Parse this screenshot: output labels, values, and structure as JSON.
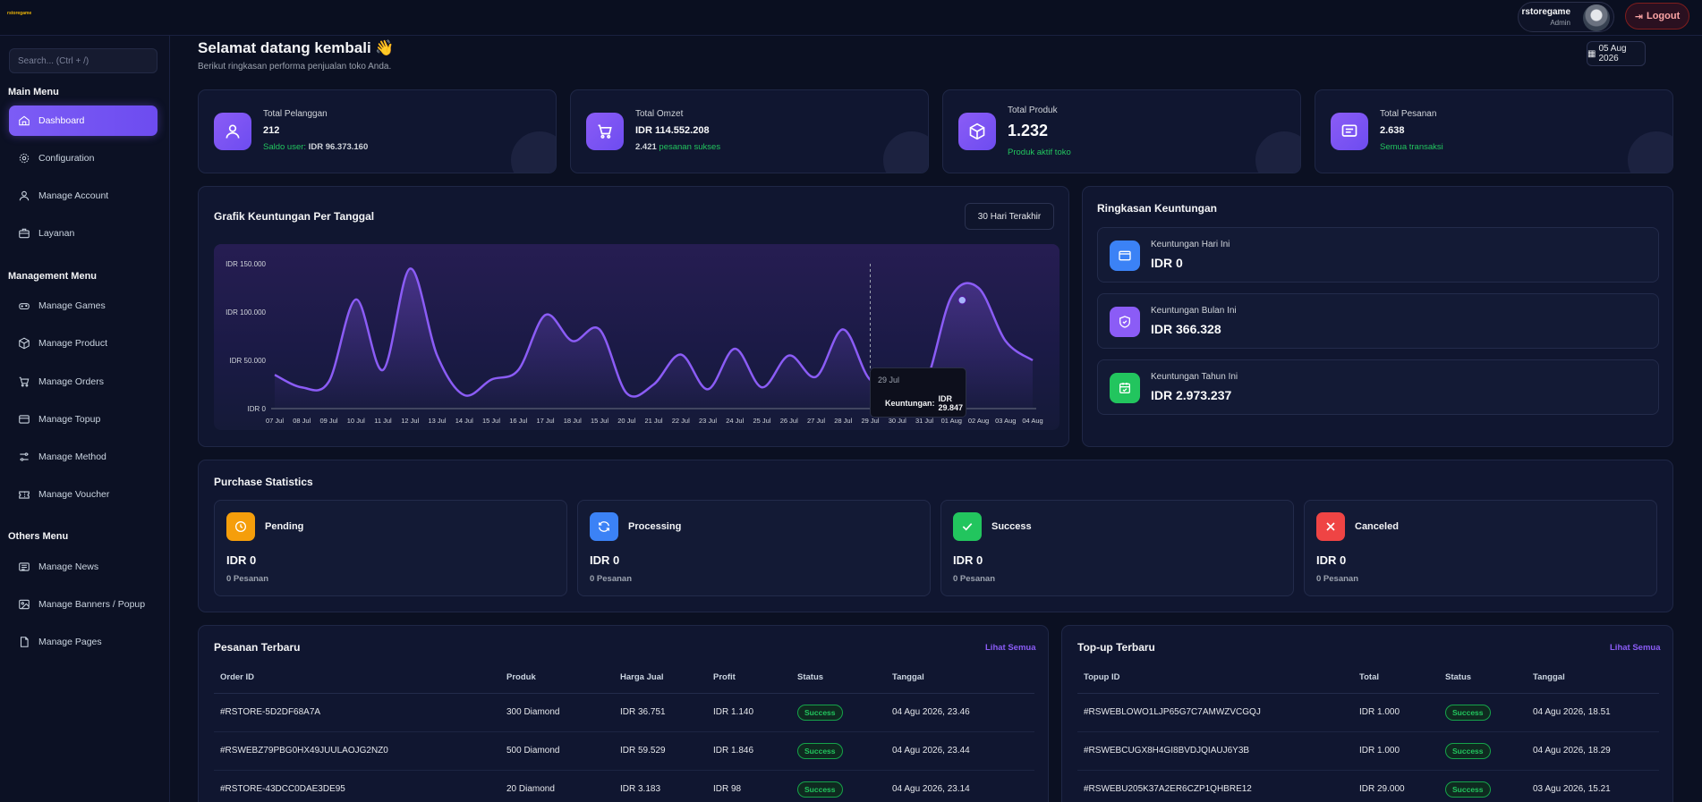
{
  "header": {
    "logo_text": "rstoregame",
    "user_name": "rstoregame",
    "user_role": "Admin",
    "logout_label": "Logout"
  },
  "sidebar": {
    "search_placeholder": "Search... (Ctrl + /)",
    "groups": [
      {
        "title": "Main Menu",
        "items": [
          "Dashboard",
          "Configuration",
          "Manage Account",
          "Layanan"
        ]
      },
      {
        "title": "Management Menu",
        "items": [
          "Manage Games",
          "Manage Product",
          "Manage Orders",
          "Manage Topup",
          "Manage Method",
          "Manage Voucher"
        ]
      },
      {
        "title": "Others Menu",
        "items": [
          "Manage News",
          "Manage Banners / Popup",
          "Manage Pages"
        ]
      }
    ]
  },
  "welcome": {
    "title": "Selamat datang kembali 👋",
    "subtitle": "Berikut ringkasan performa penjualan toko Anda.",
    "date": "05 Aug 2026"
  },
  "stats": [
    {
      "label": "Total Pelanggan",
      "value": "212",
      "extra_label": "Saldo user:",
      "extra_value": "IDR 96.373.160"
    },
    {
      "label": "Total Omzet",
      "value": "IDR 114.552.208",
      "extra_value": "2.421",
      "extra_label": "pesanan sukses"
    },
    {
      "label": "Total Produk",
      "value": "1.232",
      "extra_label": "Produk aktif toko"
    },
    {
      "label": "Total Pesanan",
      "value": "2.638",
      "extra_label": "Semua transaksi"
    }
  ],
  "profit_chart": {
    "title": "Grafik Keuntungan Per Tanggal",
    "range_label": "30 Hari Terakhir",
    "tooltip": {
      "date": "29 Jul",
      "label": "Keuntungan:",
      "value": "IDR 29.847"
    }
  },
  "chart_data": {
    "type": "line",
    "title": "Grafik Keuntungan Per Tanggal",
    "x": [
      "07 Jul",
      "08 Jul",
      "09 Jul",
      "10 Jul",
      "11 Jul",
      "12 Jul",
      "13 Jul",
      "14 Jul",
      "15 Jul",
      "16 Jul",
      "17 Jul",
      "18 Jul",
      "15 Jul",
      "20 Jul",
      "21 Jul",
      "22 Jul",
      "23 Jul",
      "24 Jul",
      "25 Jul",
      "26 Jul",
      "27 Jul",
      "28 Jul",
      "29 Jul",
      "30 Jul",
      "31 Jul",
      "01 Aug",
      "02 Aug",
      "03 Aug",
      "04 Aug"
    ],
    "values": [
      35000,
      22000,
      28000,
      113000,
      40000,
      145000,
      55000,
      14000,
      30000,
      40000,
      97000,
      70000,
      82000,
      16000,
      25000,
      56000,
      20000,
      62000,
      22000,
      55000,
      33000,
      82000,
      29847,
      35000,
      25000,
      116000,
      125000,
      70000,
      50000
    ],
    "y_ticks": [
      "IDR 150.000",
      "IDR 100.000",
      "IDR 50.000",
      "IDR 0"
    ],
    "ylim": [
      0,
      150000
    ],
    "grid": false
  },
  "summary": {
    "title": "Ringkasan Keuntungan",
    "items": [
      {
        "label": "Keuntungan Hari Ini",
        "value": "IDR 0",
        "color": "#3b82f6"
      },
      {
        "label": "Keuntungan Bulan Ini",
        "value": "IDR 366.328",
        "color": "#8b5cf6"
      },
      {
        "label": "Keuntungan Tahun Ini",
        "value": "IDR 2.973.237",
        "color": "#22c55e"
      }
    ]
  },
  "purchase": {
    "title": "Purchase Statistics",
    "items": [
      {
        "label": "Pending",
        "value": "IDR 0",
        "count": "0 Pesanan",
        "color": "#f59e0b"
      },
      {
        "label": "Processing",
        "value": "IDR 0",
        "count": "0 Pesanan",
        "color": "#3b82f6"
      },
      {
        "label": "Success",
        "value": "IDR 0",
        "count": "0 Pesanan",
        "color": "#22c55e"
      },
      {
        "label": "Canceled",
        "value": "IDR 0",
        "count": "0 Pesanan",
        "color": "#ef4444"
      }
    ]
  },
  "orders": {
    "title": "Pesanan Terbaru",
    "see_all": "Lihat Semua",
    "columns": [
      "Order ID",
      "Produk",
      "Harga Jual",
      "Profit",
      "Status",
      "Tanggal"
    ],
    "rows": [
      [
        "#RSTORE-5D2DF68A7A",
        "300 Diamond",
        "IDR 36.751",
        "IDR 1.140",
        "Success",
        "04 Agu 2026, 23.46"
      ],
      [
        "#RSWEBZ79PBG0HX49JUULAOJG2NZ0",
        "500 Diamond",
        "IDR 59.529",
        "IDR 1.846",
        "Success",
        "04 Agu 2026, 23.44"
      ],
      [
        "#RSTORE-43DCC0DAE3DE95",
        "20 Diamond",
        "IDR 3.183",
        "IDR 98",
        "Success",
        "04 Agu 2026, 23.14"
      ]
    ]
  },
  "topups": {
    "title": "Top-up Terbaru",
    "see_all": "Lihat Semua",
    "columns": [
      "Topup ID",
      "Total",
      "Status",
      "Tanggal"
    ],
    "rows": [
      [
        "#RSWEBLOWO1LJP65G7C7AMWZVCGQJ",
        "IDR 1.000",
        "Success",
        "04 Agu 2026, 18.51"
      ],
      [
        "#RSWEBCUGX8H4GI8BVDJQIAUJ6Y3B",
        "IDR 1.000",
        "Success",
        "04 Agu 2026, 18.29"
      ],
      [
        "#RSWEBU205K37A2ER6CZP1QHBRE12",
        "IDR 29.000",
        "Success",
        "03 Agu 2026, 15.21"
      ]
    ]
  }
}
